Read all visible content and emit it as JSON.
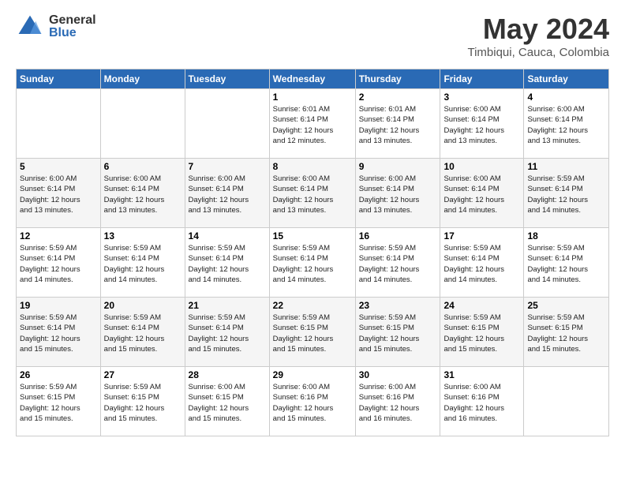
{
  "header": {
    "logo_general": "General",
    "logo_blue": "Blue",
    "title": "May 2024",
    "location": "Timbiqui, Cauca, Colombia"
  },
  "days_of_week": [
    "Sunday",
    "Monday",
    "Tuesday",
    "Wednesday",
    "Thursday",
    "Friday",
    "Saturday"
  ],
  "weeks": [
    [
      {
        "day": "",
        "info": ""
      },
      {
        "day": "",
        "info": ""
      },
      {
        "day": "",
        "info": ""
      },
      {
        "day": "1",
        "info": "Sunrise: 6:01 AM\nSunset: 6:14 PM\nDaylight: 12 hours\nand 12 minutes."
      },
      {
        "day": "2",
        "info": "Sunrise: 6:01 AM\nSunset: 6:14 PM\nDaylight: 12 hours\nand 13 minutes."
      },
      {
        "day": "3",
        "info": "Sunrise: 6:00 AM\nSunset: 6:14 PM\nDaylight: 12 hours\nand 13 minutes."
      },
      {
        "day": "4",
        "info": "Sunrise: 6:00 AM\nSunset: 6:14 PM\nDaylight: 12 hours\nand 13 minutes."
      }
    ],
    [
      {
        "day": "5",
        "info": "Sunrise: 6:00 AM\nSunset: 6:14 PM\nDaylight: 12 hours\nand 13 minutes."
      },
      {
        "day": "6",
        "info": "Sunrise: 6:00 AM\nSunset: 6:14 PM\nDaylight: 12 hours\nand 13 minutes."
      },
      {
        "day": "7",
        "info": "Sunrise: 6:00 AM\nSunset: 6:14 PM\nDaylight: 12 hours\nand 13 minutes."
      },
      {
        "day": "8",
        "info": "Sunrise: 6:00 AM\nSunset: 6:14 PM\nDaylight: 12 hours\nand 13 minutes."
      },
      {
        "day": "9",
        "info": "Sunrise: 6:00 AM\nSunset: 6:14 PM\nDaylight: 12 hours\nand 13 minutes."
      },
      {
        "day": "10",
        "info": "Sunrise: 6:00 AM\nSunset: 6:14 PM\nDaylight: 12 hours\nand 14 minutes."
      },
      {
        "day": "11",
        "info": "Sunrise: 5:59 AM\nSunset: 6:14 PM\nDaylight: 12 hours\nand 14 minutes."
      }
    ],
    [
      {
        "day": "12",
        "info": "Sunrise: 5:59 AM\nSunset: 6:14 PM\nDaylight: 12 hours\nand 14 minutes."
      },
      {
        "day": "13",
        "info": "Sunrise: 5:59 AM\nSunset: 6:14 PM\nDaylight: 12 hours\nand 14 minutes."
      },
      {
        "day": "14",
        "info": "Sunrise: 5:59 AM\nSunset: 6:14 PM\nDaylight: 12 hours\nand 14 minutes."
      },
      {
        "day": "15",
        "info": "Sunrise: 5:59 AM\nSunset: 6:14 PM\nDaylight: 12 hours\nand 14 minutes."
      },
      {
        "day": "16",
        "info": "Sunrise: 5:59 AM\nSunset: 6:14 PM\nDaylight: 12 hours\nand 14 minutes."
      },
      {
        "day": "17",
        "info": "Sunrise: 5:59 AM\nSunset: 6:14 PM\nDaylight: 12 hours\nand 14 minutes."
      },
      {
        "day": "18",
        "info": "Sunrise: 5:59 AM\nSunset: 6:14 PM\nDaylight: 12 hours\nand 14 minutes."
      }
    ],
    [
      {
        "day": "19",
        "info": "Sunrise: 5:59 AM\nSunset: 6:14 PM\nDaylight: 12 hours\nand 15 minutes."
      },
      {
        "day": "20",
        "info": "Sunrise: 5:59 AM\nSunset: 6:14 PM\nDaylight: 12 hours\nand 15 minutes."
      },
      {
        "day": "21",
        "info": "Sunrise: 5:59 AM\nSunset: 6:14 PM\nDaylight: 12 hours\nand 15 minutes."
      },
      {
        "day": "22",
        "info": "Sunrise: 5:59 AM\nSunset: 6:15 PM\nDaylight: 12 hours\nand 15 minutes."
      },
      {
        "day": "23",
        "info": "Sunrise: 5:59 AM\nSunset: 6:15 PM\nDaylight: 12 hours\nand 15 minutes."
      },
      {
        "day": "24",
        "info": "Sunrise: 5:59 AM\nSunset: 6:15 PM\nDaylight: 12 hours\nand 15 minutes."
      },
      {
        "day": "25",
        "info": "Sunrise: 5:59 AM\nSunset: 6:15 PM\nDaylight: 12 hours\nand 15 minutes."
      }
    ],
    [
      {
        "day": "26",
        "info": "Sunrise: 5:59 AM\nSunset: 6:15 PM\nDaylight: 12 hours\nand 15 minutes."
      },
      {
        "day": "27",
        "info": "Sunrise: 5:59 AM\nSunset: 6:15 PM\nDaylight: 12 hours\nand 15 minutes."
      },
      {
        "day": "28",
        "info": "Sunrise: 6:00 AM\nSunset: 6:15 PM\nDaylight: 12 hours\nand 15 minutes."
      },
      {
        "day": "29",
        "info": "Sunrise: 6:00 AM\nSunset: 6:16 PM\nDaylight: 12 hours\nand 15 minutes."
      },
      {
        "day": "30",
        "info": "Sunrise: 6:00 AM\nSunset: 6:16 PM\nDaylight: 12 hours\nand 16 minutes."
      },
      {
        "day": "31",
        "info": "Sunrise: 6:00 AM\nSunset: 6:16 PM\nDaylight: 12 hours\nand 16 minutes."
      },
      {
        "day": "",
        "info": ""
      }
    ]
  ]
}
